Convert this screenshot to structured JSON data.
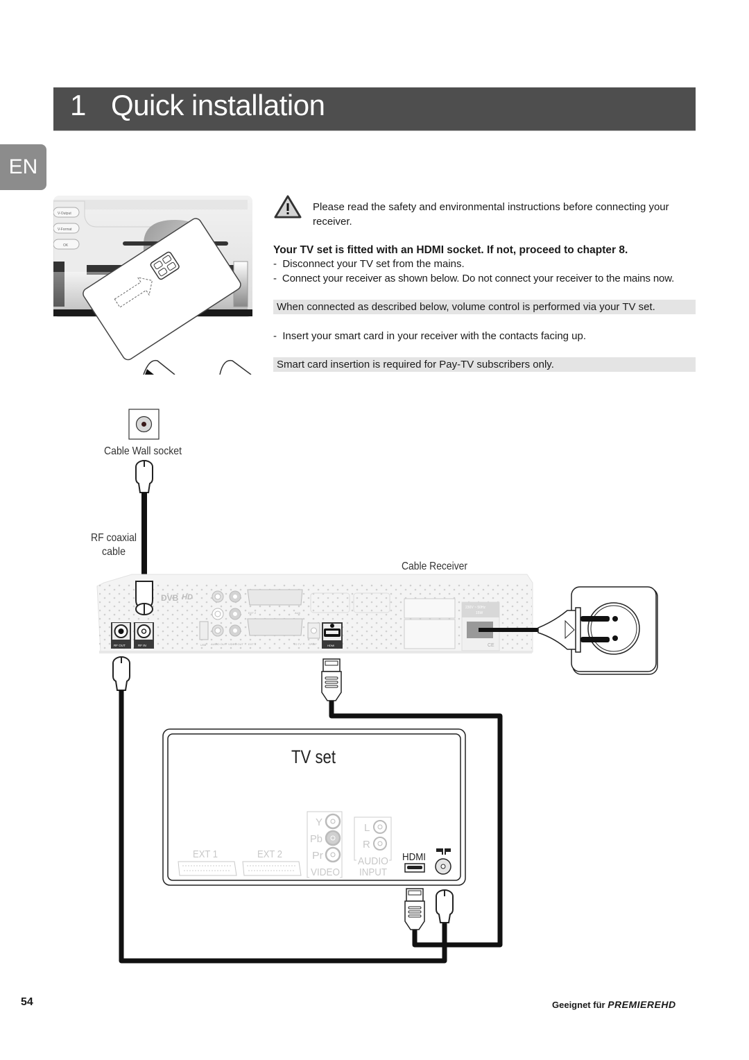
{
  "page": {
    "chapter_number": "1",
    "chapter_title": "Quick installation",
    "language_tab": "EN",
    "page_number": "54",
    "footer_text": "Geeignet für",
    "footer_brand": "PREMIEREHD"
  },
  "instructions": {
    "warning_text": "Please read the safety and environmental instructions before connecting your receiver.",
    "heading": "Your TV set is fitted with an HDMI socket. If not, proceed to chapter 8.",
    "steps": [
      "Disconnect your TV set from the mains.",
      "Connect your receiver as shown below. Do not connect your receiver to the mains now."
    ],
    "note_volume": "When connected as described below, volume control is performed via your TV set.",
    "step_smartcard": "Insert your smart card in your receiver with the contacts facing up.",
    "note_smartcard": "Smart card insertion is required for Pay-TV subscribers only.",
    "bullet": "-"
  },
  "smartcard_illustration": {
    "buttons": [
      "V-Output",
      "V-Format",
      "OK"
    ]
  },
  "diagram": {
    "wall_socket_label": "Cable Wall socket",
    "cable_label_line1": "RF coaxial",
    "cable_label_line2": "cable",
    "receiver_label": "Cable Receiver",
    "receiver_ports": {
      "rf_out": "RF OUT",
      "rf_in": "RF IN",
      "usb": "USB",
      "audio_out": "AUDIO OUT",
      "video_out": "VIDEO OUT",
      "ext1": "EXT 1",
      "ext2": "EXT 2",
      "to_tv": "TO TV",
      "aux": "AUX",
      "spdif": "SPDIF",
      "hdmi": "HDMI",
      "power_rating_line1": "230V ~ 50Hz",
      "power_rating_line2": "15W",
      "dvb_logo": "DVB",
      "hd_logo": "HD"
    },
    "tv_label": "TV set",
    "tv_ports": {
      "ext1": "EXT 1",
      "ext2": "EXT 2",
      "y": "Y",
      "pb": "Pb",
      "pr": "Pr",
      "video": "VIDEO",
      "l": "L",
      "r": "R",
      "audio": "AUDIO",
      "input": "INPUT",
      "hdmi": "HDMI"
    }
  }
}
